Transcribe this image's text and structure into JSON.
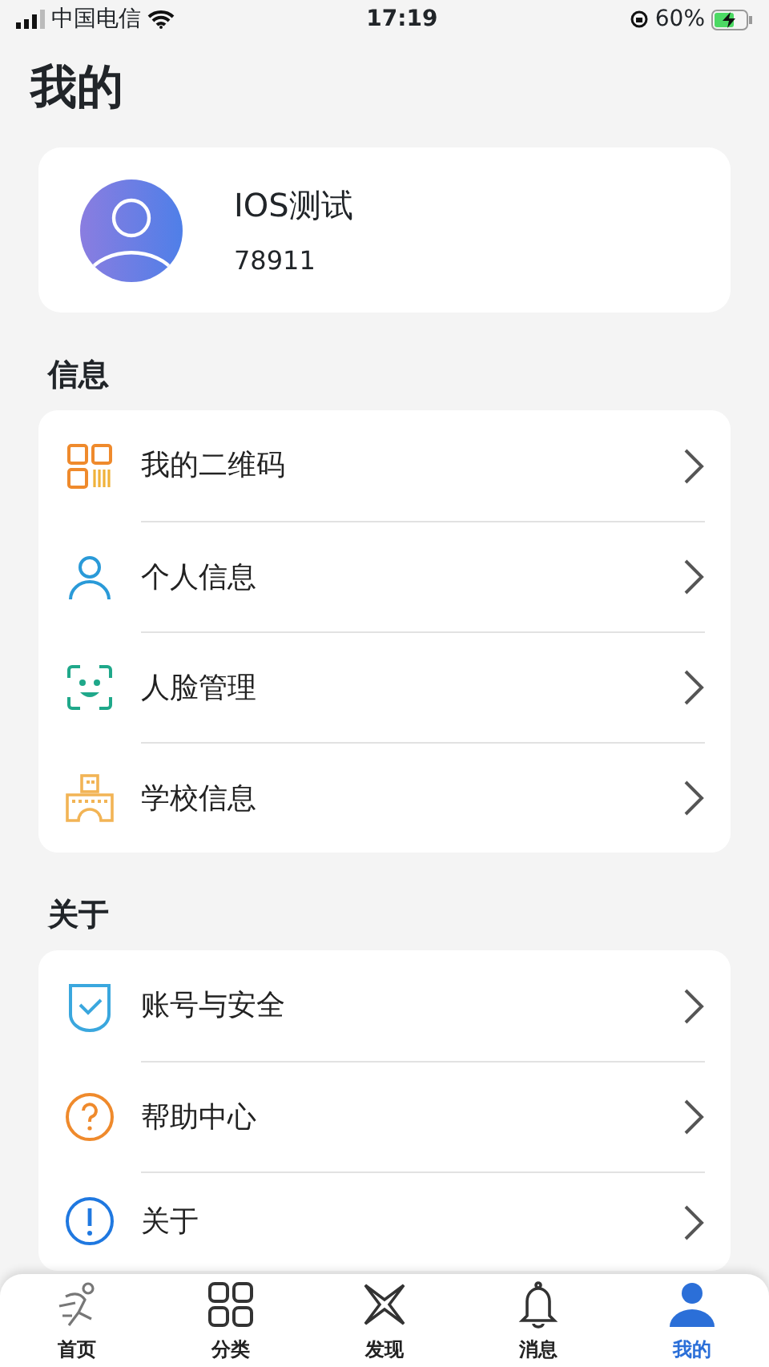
{
  "status_bar": {
    "carrier": "中国电信",
    "time": "17:19",
    "battery": "60%"
  },
  "title": "我的",
  "profile": {
    "name": "IOS测试",
    "id": "78911"
  },
  "sections": [
    {
      "heading": "信息",
      "items": [
        {
          "label": "我的二维码",
          "kind": "qr"
        },
        {
          "label": "个人信息",
          "kind": "person"
        },
        {
          "label": "人脸管理",
          "kind": "face"
        },
        {
          "label": "学校信息",
          "kind": "school"
        }
      ]
    },
    {
      "heading": "关于",
      "items": [
        {
          "label": "账号与安全",
          "kind": "shield"
        },
        {
          "label": "帮助中心",
          "kind": "help"
        },
        {
          "label": "关于",
          "kind": "info"
        }
      ]
    }
  ],
  "tabs": [
    {
      "label": "首页",
      "kind": "home",
      "selected": false
    },
    {
      "label": "分类",
      "kind": "grid",
      "selected": false
    },
    {
      "label": "发现",
      "kind": "discover",
      "selected": false
    },
    {
      "label": "消息",
      "kind": "bell",
      "selected": false
    },
    {
      "label": "我的",
      "kind": "user",
      "selected": true
    }
  ]
}
